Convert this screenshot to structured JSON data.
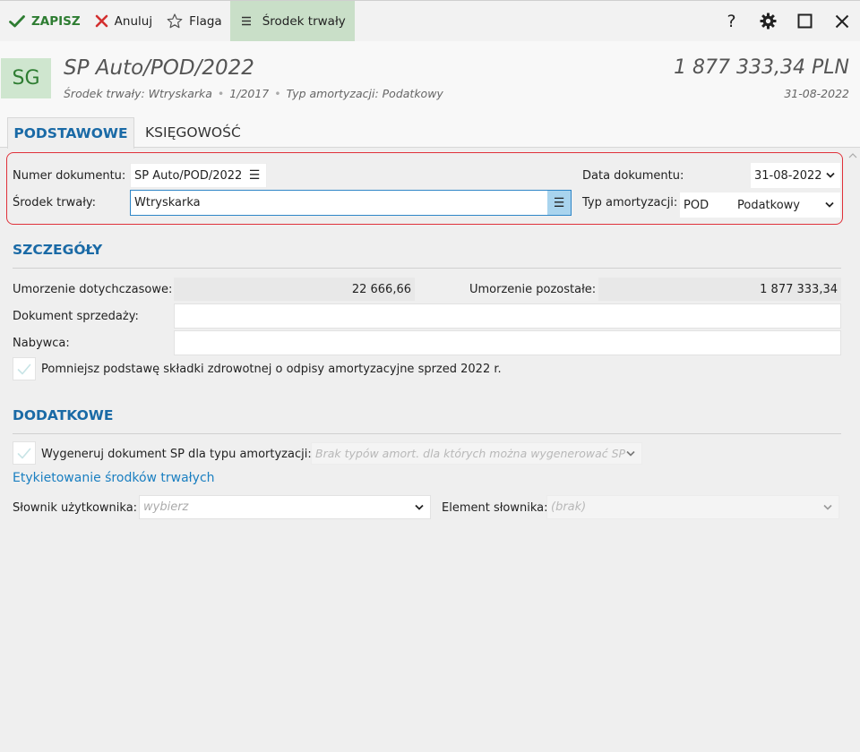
{
  "toolbar": {
    "save_label": "ZAPISZ",
    "cancel_label": "Anuluj",
    "flag_label": "Flaga",
    "asset_label": "Środek trwały",
    "help_label": "?"
  },
  "header": {
    "avatar": "SG",
    "title": "SP Auto/POD/2022",
    "sub_asset": "Środek trwały: Wtryskarka",
    "sub_number": "1/2017",
    "sub_type": "Typ amortyzacji: Podatkowy",
    "amount": "1 877 333,34 PLN",
    "date": "31-08-2022"
  },
  "tabs": [
    {
      "label": "PODSTAWOWE",
      "active": true
    },
    {
      "label": "KSIĘGOWOŚĆ",
      "active": false
    }
  ],
  "form": {
    "doc_number_label": "Numer dokumentu:",
    "doc_number_value": "SP Auto/POD/2022",
    "asset_label": "Środek trwały:",
    "asset_value": "Wtryskarka",
    "doc_date_label": "Data dokumentu:",
    "doc_date_value": "31-08-2022",
    "amort_type_label": "Typ amortyzacji:",
    "amort_type_code": "POD",
    "amort_type_value": "Podatkowy"
  },
  "details": {
    "title": "SZCZEGÓŁY",
    "dep_to_date_label": "Umorzenie dotychczasowe:",
    "dep_to_date_value": "22 666,66",
    "dep_remaining_label": "Umorzenie pozostałe:",
    "dep_remaining_value": "1 877 333,34",
    "sale_doc_label": "Dokument sprzedaży:",
    "sale_doc_value": "",
    "buyer_label": "Nabywca:",
    "buyer_value": "",
    "health_checkbox_label": "Pomniejsz podstawę składki zdrowotnej o odpisy amortyzacyjne sprzed 2022 r."
  },
  "additional": {
    "title": "DODATKOWE",
    "generate_label": "Wygeneruj dokument SP dla typu amortyzacji:",
    "generate_placeholder": "Brak typów amort. dla których można wygenerować SP",
    "labeling_link": "Etykietowanie środków trwałych",
    "dict_label": "Słownik użytkownika:",
    "dict_placeholder": "wybierz",
    "dict_element_label": "Element słownika:",
    "dict_element_placeholder": "(brak)"
  },
  "colors": {
    "accent_blue": "#1a6aa6",
    "save_green": "#2e7d32",
    "cancel_red": "#d32f2f",
    "highlight_red": "#e0313a"
  }
}
